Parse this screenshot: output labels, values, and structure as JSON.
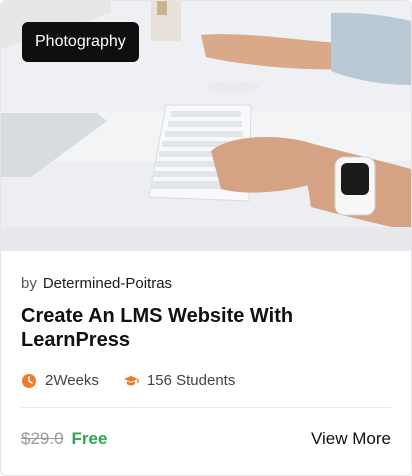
{
  "course": {
    "category": "Photography",
    "author_prefix": "by",
    "author_name": "Determined-Poitras",
    "title": "Create An LMS Website With LearnPress",
    "duration": "2Weeks",
    "students": "156 Students",
    "old_price": "$29.0",
    "price": "Free",
    "cta": "View More"
  },
  "colors": {
    "accent_orange": "#f07c2b",
    "free_green": "#2ea84f",
    "badge_bg": "#0f0f10"
  },
  "icons": {
    "duration": "clock-icon",
    "students": "graduation-cap-icon"
  }
}
